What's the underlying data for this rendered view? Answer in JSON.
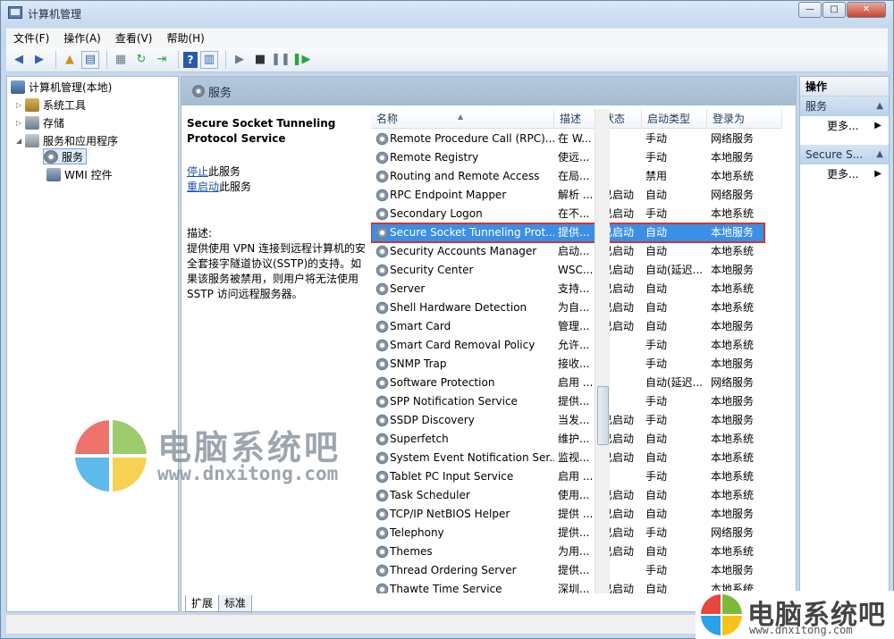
{
  "window": {
    "title": "计算机管理",
    "controls": [
      "—",
      "□",
      "✕"
    ]
  },
  "menu": [
    "文件(F)",
    "操作(A)",
    "查看(V)",
    "帮助(H)"
  ],
  "tree": {
    "root": "计算机管理(本地)",
    "system_tools": "系统工具",
    "storage": "存储",
    "services_apps": "服务和应用程序",
    "services": "服务",
    "wmi": "WMI 控件"
  },
  "center": {
    "header": "服务",
    "selected_title": "Secure Socket Tunneling Protocol Service",
    "stop_link": "停止",
    "stop_suffix": "此服务",
    "restart_link": "重启动",
    "restart_suffix": "此服务",
    "desc_label": "描述:",
    "description": "提供使用 VPN 连接到远程计算机的安全套接字隧道协议(SSTP)的支持。如果该服务被禁用，则用户将无法使用 SSTP 访问远程服务器。",
    "columns": [
      "名称",
      "描述",
      "状态",
      "启动类型",
      "登录为"
    ],
    "tabs": [
      "扩展",
      "标准"
    ]
  },
  "services": [
    {
      "name": "Remote Procedure Call (RPC)...",
      "desc": "在 W...",
      "status": "",
      "startup": "手动",
      "logon": "网络服务"
    },
    {
      "name": "Remote Registry",
      "desc": "使远...",
      "status": "",
      "startup": "手动",
      "logon": "本地服务"
    },
    {
      "name": "Routing and Remote Access",
      "desc": "在局...",
      "status": "",
      "startup": "禁用",
      "logon": "本地系统"
    },
    {
      "name": "RPC Endpoint Mapper",
      "desc": "解析 ...",
      "status": "已启动",
      "startup": "自动",
      "logon": "网络服务"
    },
    {
      "name": "Secondary Logon",
      "desc": "在不...",
      "status": "已启动",
      "startup": "手动",
      "logon": "本地系统"
    },
    {
      "name": "Secure Socket Tunneling Prot...",
      "desc": "提供...",
      "status": "已启动",
      "startup": "自动",
      "logon": "本地服务",
      "selected": true
    },
    {
      "name": "Security Accounts Manager",
      "desc": "启动...",
      "status": "已启动",
      "startup": "自动",
      "logon": "本地系统"
    },
    {
      "name": "Security Center",
      "desc": "WSC...",
      "status": "已启动",
      "startup": "自动(延迟...",
      "logon": "本地服务"
    },
    {
      "name": "Server",
      "desc": "支持...",
      "status": "已启动",
      "startup": "自动",
      "logon": "本地系统"
    },
    {
      "name": "Shell Hardware Detection",
      "desc": "为自...",
      "status": "已启动",
      "startup": "自动",
      "logon": "本地系统"
    },
    {
      "name": "Smart Card",
      "desc": "管理...",
      "status": "已启动",
      "startup": "自动",
      "logon": "本地服务"
    },
    {
      "name": "Smart Card Removal Policy",
      "desc": "允许...",
      "status": "",
      "startup": "手动",
      "logon": "本地系统"
    },
    {
      "name": "SNMP Trap",
      "desc": "接收...",
      "status": "",
      "startup": "手动",
      "logon": "本地服务"
    },
    {
      "name": "Software Protection",
      "desc": "启用 ...",
      "status": "",
      "startup": "自动(延迟...",
      "logon": "网络服务"
    },
    {
      "name": "SPP Notification Service",
      "desc": "提供...",
      "status": "",
      "startup": "手动",
      "logon": "本地服务"
    },
    {
      "name": "SSDP Discovery",
      "desc": "当发...",
      "status": "已启动",
      "startup": "手动",
      "logon": "本地服务"
    },
    {
      "name": "Superfetch",
      "desc": "维护...",
      "status": "已启动",
      "startup": "自动",
      "logon": "本地系统"
    },
    {
      "name": "System Event Notification Ser...",
      "desc": "监视...",
      "status": "已启动",
      "startup": "自动",
      "logon": "本地系统"
    },
    {
      "name": "Tablet PC Input Service",
      "desc": "启用 ...",
      "status": "",
      "startup": "手动",
      "logon": "本地系统"
    },
    {
      "name": "Task Scheduler",
      "desc": "使用...",
      "status": "已启动",
      "startup": "自动",
      "logon": "本地系统"
    },
    {
      "name": "TCP/IP NetBIOS Helper",
      "desc": "提供 ...",
      "status": "已启动",
      "startup": "自动",
      "logon": "本地服务"
    },
    {
      "name": "Telephony",
      "desc": "提供...",
      "status": "已启动",
      "startup": "手动",
      "logon": "网络服务"
    },
    {
      "name": "Themes",
      "desc": "为用...",
      "status": "已启动",
      "startup": "自动",
      "logon": "本地系统"
    },
    {
      "name": "Thread Ordering Server",
      "desc": "提供...",
      "status": "",
      "startup": "手动",
      "logon": "本地服务"
    },
    {
      "name": "Thawte Time Service",
      "desc": "深圳...",
      "status": "已启动",
      "startup": "自动",
      "logon": "本地系统"
    }
  ],
  "actions": {
    "header": "操作",
    "section1": "服务",
    "more1": "更多...",
    "section2": "Secure S...",
    "more2": "更多..."
  },
  "watermark": {
    "name": "电脑系统吧",
    "url": "www.dnxitong.com"
  },
  "colors": {
    "selection": "#3a8fe6",
    "highlight_border": "#d0352d",
    "logo": [
      "#e8453c",
      "#7cbb3a",
      "#29a3e4",
      "#f6c21b"
    ]
  }
}
